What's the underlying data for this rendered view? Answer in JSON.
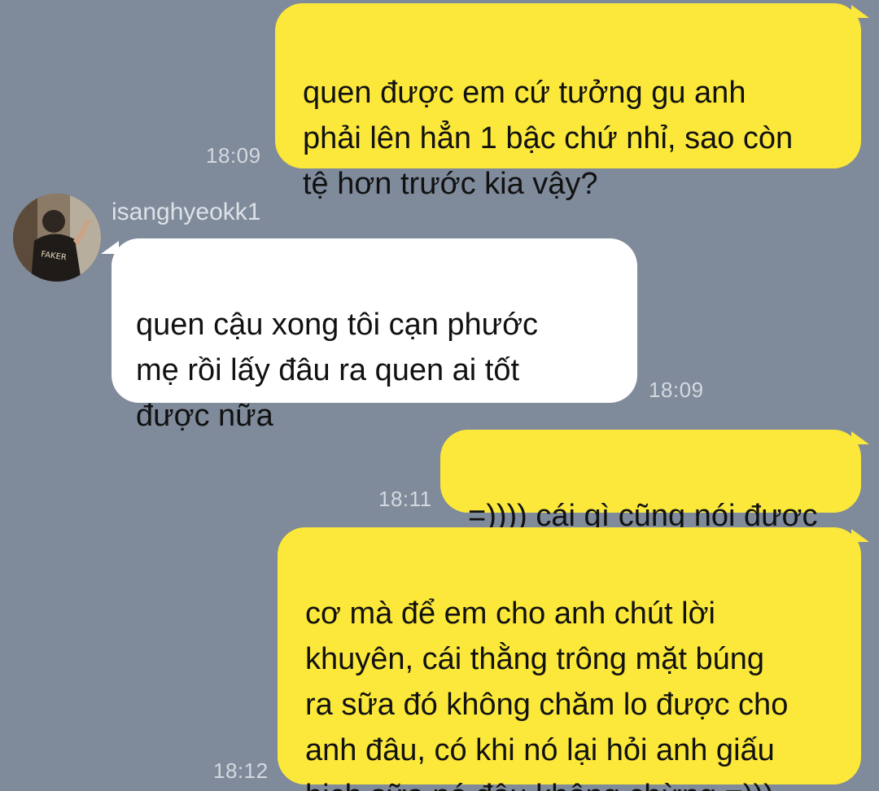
{
  "chat": {
    "contact_name": "isanghyeokk1",
    "avatar_text": "FAKER",
    "messages": [
      {
        "sender": "me",
        "text": "quen được em cứ tưởng gu anh\nphải lên hẳn 1 bậc chứ nhỉ, sao còn\ntệ hơn trước kia vậy?",
        "time": "18:09"
      },
      {
        "sender": "them",
        "text": "quen cậu xong tôi cạn phước\nmẹ rồi lấy đâu ra quen ai tốt\nđược nữa",
        "time": "18:09"
      },
      {
        "sender": "me",
        "text": "=)))) cái gì cũng nói được",
        "time": "18:11"
      },
      {
        "sender": "me",
        "text": "cơ mà để em cho anh chút lời\nkhuyên, cái thằng trông mặt búng\nra sữa đó không chăm lo được cho\nanh đâu, có khi nó lại hỏi anh giấu\nbịch sữa nó đâu không chừng =)))",
        "time": "18:12"
      }
    ]
  },
  "colors": {
    "background": "#7F8A9A",
    "my_bubble": "#FBE83A",
    "their_bubble": "#FFFFFF",
    "timestamp": "#D4D9E0"
  }
}
